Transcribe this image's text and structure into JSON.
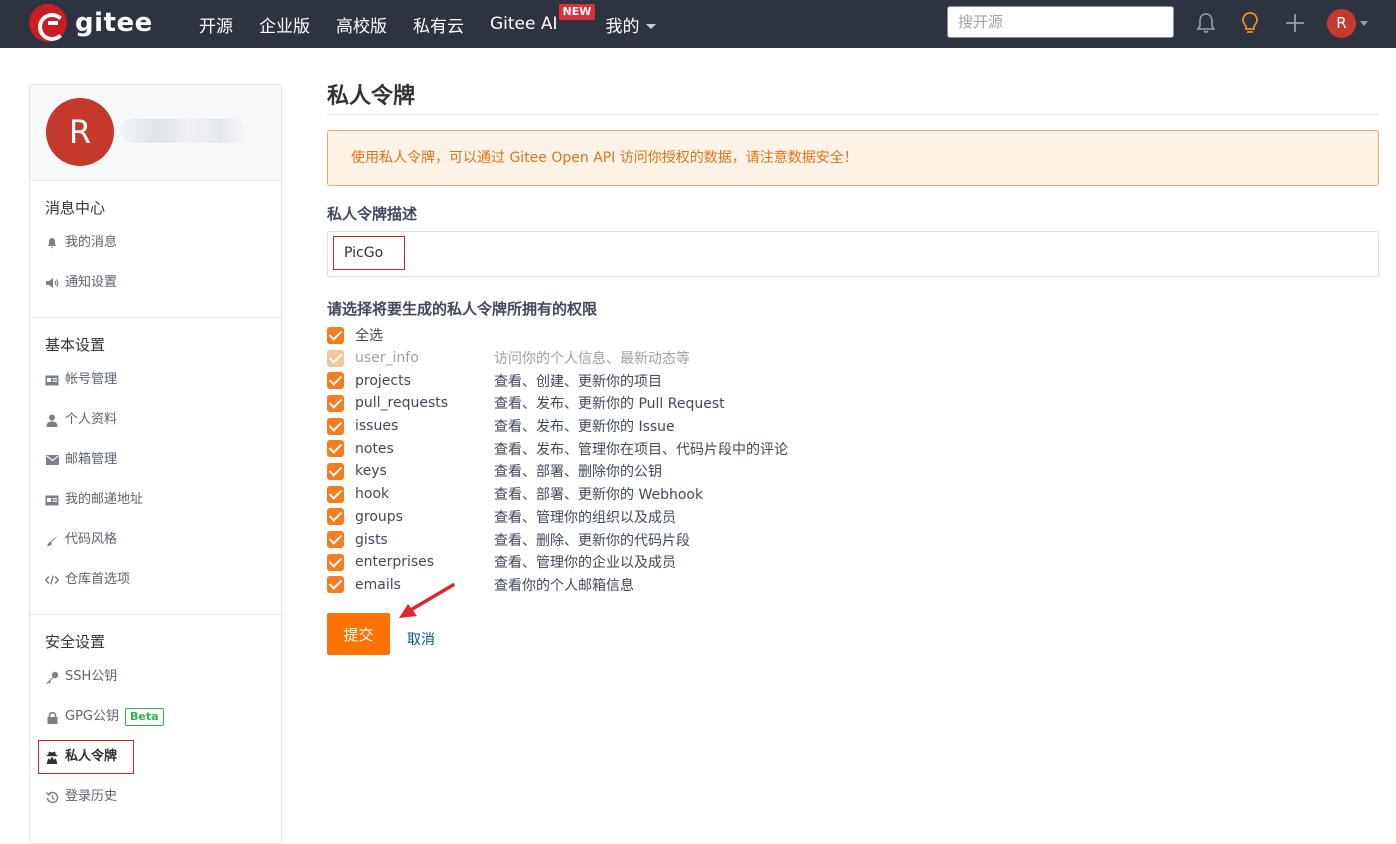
{
  "header": {
    "brand": "gitee",
    "nav": [
      {
        "label": "开源"
      },
      {
        "label": "企业版"
      },
      {
        "label": "高校版"
      },
      {
        "label": "私有云"
      },
      {
        "label": "Gitee AI",
        "badge": "NEW"
      },
      {
        "label": "我的"
      }
    ],
    "search_placeholder": "搜开源",
    "avatar_letter": "R",
    "icons": [
      "bell-icon",
      "lightbulb-icon",
      "plus-icon"
    ]
  },
  "sidebar": {
    "avatar_letter": "R",
    "sections": [
      {
        "title": "消息中心",
        "items": [
          {
            "label": "我的消息",
            "icon": "bell-icon"
          },
          {
            "label": "通知设置",
            "icon": "volume-icon"
          }
        ]
      },
      {
        "title": "基本设置",
        "items": [
          {
            "label": "帐号管理",
            "icon": "id-card-icon"
          },
          {
            "label": "个人资料",
            "icon": "user-icon"
          },
          {
            "label": "邮箱管理",
            "icon": "envelope-icon"
          },
          {
            "label": "我的邮递地址",
            "icon": "address-card-icon"
          },
          {
            "label": "代码风格",
            "icon": "brush-icon"
          },
          {
            "label": "仓库首选项",
            "icon": "code-icon"
          }
        ]
      },
      {
        "title": "安全设置",
        "items": [
          {
            "label": "SSH公钥",
            "icon": "key-icon"
          },
          {
            "label": "GPG公钥",
            "icon": "lock-icon",
            "badge": "Beta"
          },
          {
            "label": "私人令牌",
            "icon": "user-secret-icon",
            "active": true
          },
          {
            "label": "登录历史",
            "icon": "history-icon"
          }
        ]
      }
    ]
  },
  "main": {
    "title": "私人令牌",
    "notice": "使用私人令牌，可以通过 Gitee Open API 访问你授权的数据，请注意数据安全！",
    "desc_label": "私人令牌描述",
    "desc_value": "PicGo",
    "perm_label": "请选择将要生成的私人令牌所拥有的权限",
    "permissions": [
      {
        "name": "全选",
        "desc": "",
        "checked": true,
        "disabled": false
      },
      {
        "name": "user_info",
        "desc": "访问你的个人信息、最新动态等",
        "checked": true,
        "disabled": true
      },
      {
        "name": "projects",
        "desc": "查看、创建、更新你的项目",
        "checked": true,
        "disabled": false
      },
      {
        "name": "pull_requests",
        "desc": "查看、发布、更新你的 Pull Request",
        "checked": true,
        "disabled": false
      },
      {
        "name": "issues",
        "desc": "查看、发布、更新你的 Issue",
        "checked": true,
        "disabled": false
      },
      {
        "name": "notes",
        "desc": "查看、发布、管理你在项目、代码片段中的评论",
        "checked": true,
        "disabled": false
      },
      {
        "name": "keys",
        "desc": "查看、部署、删除你的公钥",
        "checked": true,
        "disabled": false
      },
      {
        "name": "hook",
        "desc": "查看、部署、更新你的 Webhook",
        "checked": true,
        "disabled": false
      },
      {
        "name": "groups",
        "desc": "查看、管理你的组织以及成员",
        "checked": true,
        "disabled": false
      },
      {
        "name": "gists",
        "desc": "查看、删除、更新你的代码片段",
        "checked": true,
        "disabled": false
      },
      {
        "name": "enterprises",
        "desc": "查看、管理你的企业以及成员",
        "checked": true,
        "disabled": false
      },
      {
        "name": "emails",
        "desc": "查看你的个人邮箱信息",
        "checked": true,
        "disabled": false
      }
    ],
    "submit_label": "提交",
    "cancel_label": "取消"
  },
  "colors": {
    "header_bg": "#2e3340",
    "accent": "#fe7300",
    "brand_red": "#c71d23",
    "highlight_box": "#c0282e"
  }
}
